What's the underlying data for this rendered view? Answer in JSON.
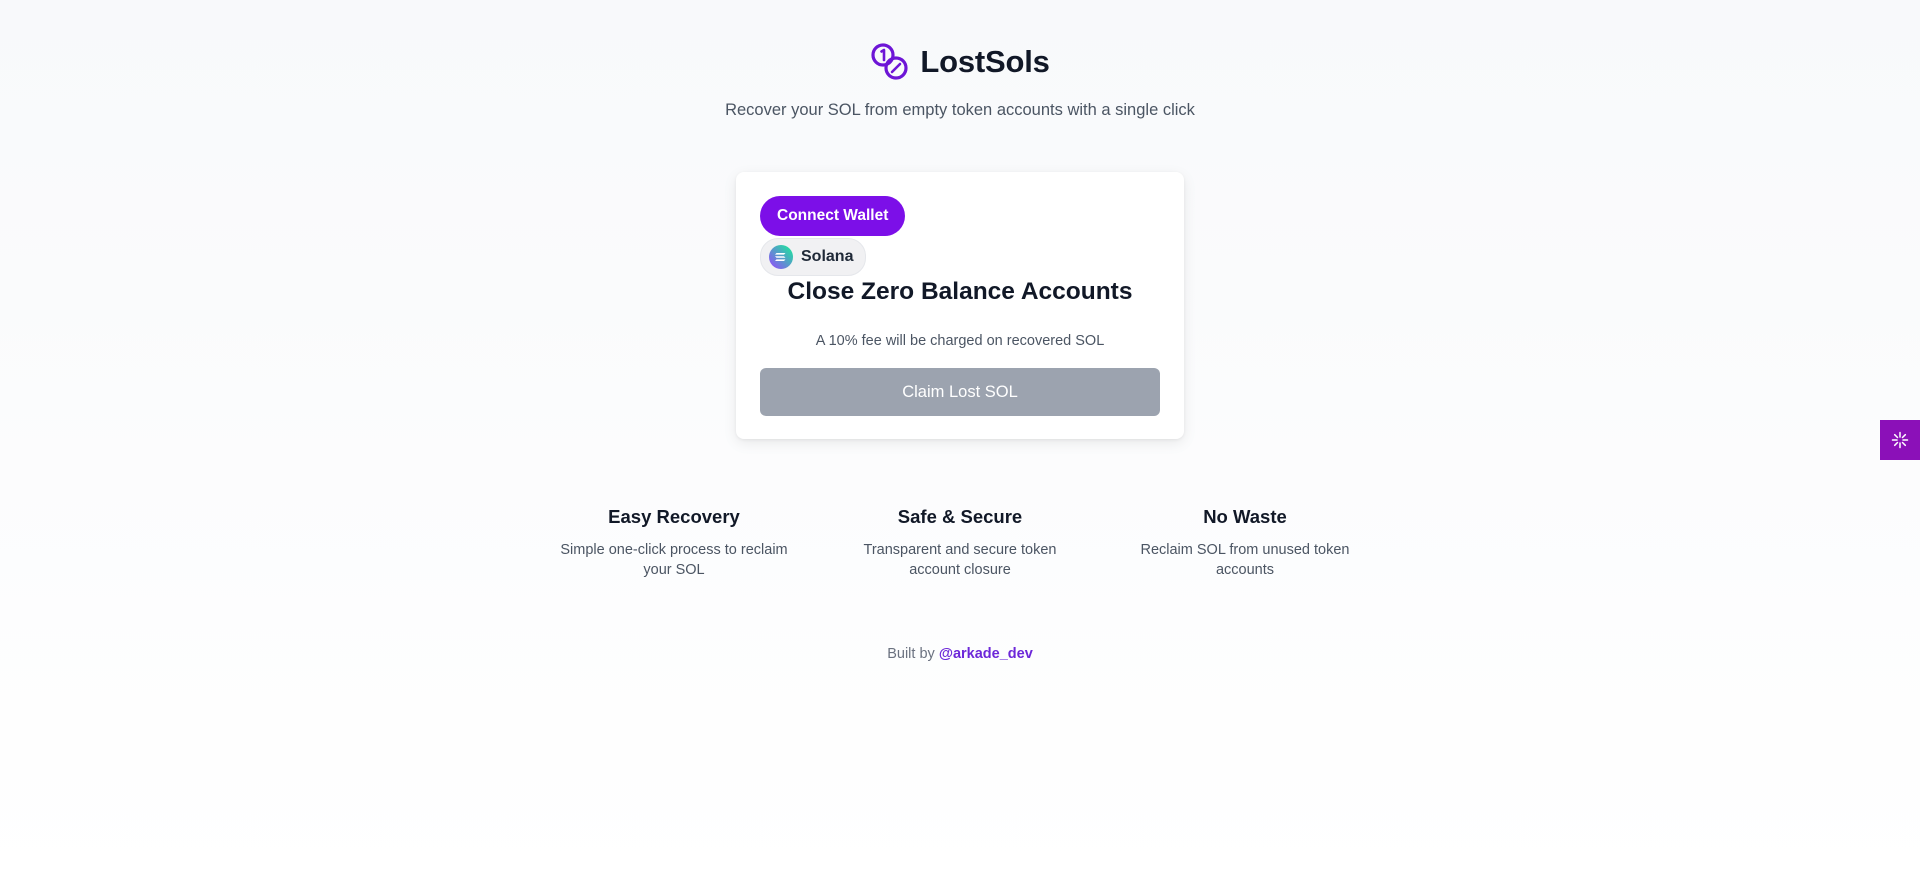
{
  "header": {
    "brand": "LostSols",
    "tagline": "Recover your SOL from empty token accounts with a single click"
  },
  "card": {
    "connect_label": "Connect Wallet",
    "network_label": "Solana",
    "title": "Close Zero Balance Accounts",
    "fee_note": "A 10% fee will be charged on recovered SOL",
    "claim_label": "Claim Lost SOL"
  },
  "features": [
    {
      "title": "Easy Recovery",
      "desc": "Simple one-click process to reclaim your SOL"
    },
    {
      "title": "Safe & Secure",
      "desc": "Transparent and secure token account closure"
    },
    {
      "title": "No Waste",
      "desc": "Reclaim SOL from unused token accounts"
    }
  ],
  "footer": {
    "prefix": "Built by",
    "link_text": "@arkade_dev"
  },
  "icons": {
    "logo": "linked-coins-icon",
    "network": "solana-icon",
    "side_widget": "sparkle-icon"
  },
  "colors": {
    "accent": "#7c0fe8",
    "claim_disabled": "#9ca3af",
    "link": "#6d28d9",
    "side_widget": "#8b10b8"
  }
}
